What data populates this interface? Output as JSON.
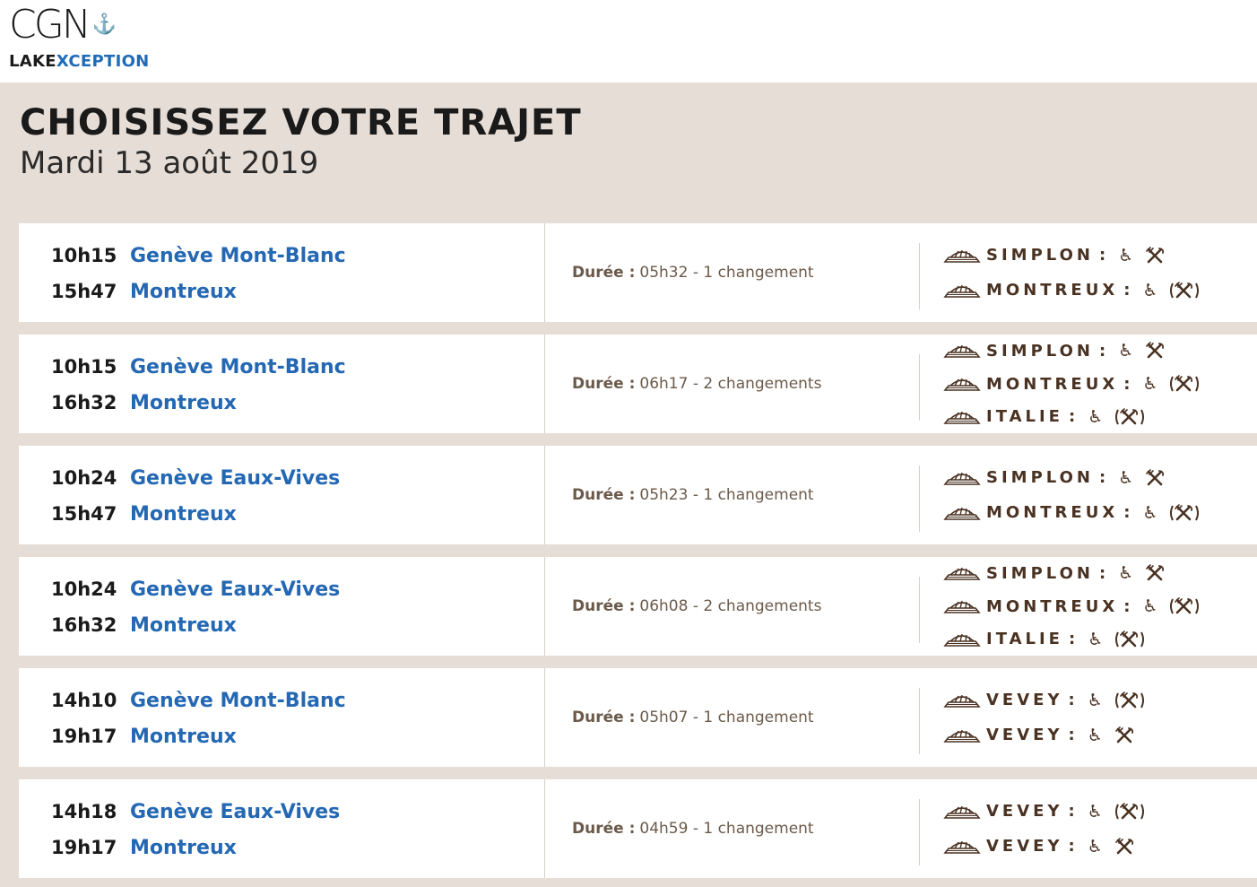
{
  "brand": {
    "logo_text": "CGN",
    "logo_anchor": "⚓",
    "tagline_a": "LAKE",
    "tagline_b": "XCEPTION"
  },
  "page": {
    "title": "CHOISISSEZ VOTRE TRAJET",
    "date": "Mardi 13 août 2019"
  },
  "duration_label": "Durée :",
  "trips": [
    {
      "dep_time": "10h15",
      "dep_place": "Genève Mont-Blanc",
      "arr_time": "15h47",
      "arr_place": "Montreux",
      "duration": "05h32 - 1 changement",
      "boats": [
        {
          "name": "SIMPLON",
          "restaurant": "yes"
        },
        {
          "name": "MONTREUX",
          "restaurant": "optional"
        }
      ]
    },
    {
      "dep_time": "10h15",
      "dep_place": "Genève Mont-Blanc",
      "arr_time": "16h32",
      "arr_place": "Montreux",
      "duration": "06h17 - 2 changements",
      "boats": [
        {
          "name": "SIMPLON",
          "restaurant": "yes"
        },
        {
          "name": "MONTREUX",
          "restaurant": "optional"
        },
        {
          "name": "ITALIE",
          "restaurant": "optional"
        }
      ]
    },
    {
      "dep_time": "10h24",
      "dep_place": "Genève Eaux-Vives",
      "arr_time": "15h47",
      "arr_place": "Montreux",
      "duration": "05h23 - 1 changement",
      "boats": [
        {
          "name": "SIMPLON",
          "restaurant": "yes"
        },
        {
          "name": "MONTREUX",
          "restaurant": "optional"
        }
      ]
    },
    {
      "dep_time": "10h24",
      "dep_place": "Genève Eaux-Vives",
      "arr_time": "16h32",
      "arr_place": "Montreux",
      "duration": "06h08 - 2 changements",
      "boats": [
        {
          "name": "SIMPLON",
          "restaurant": "yes"
        },
        {
          "name": "MONTREUX",
          "restaurant": "optional"
        },
        {
          "name": "ITALIE",
          "restaurant": "optional"
        }
      ]
    },
    {
      "dep_time": "14h10",
      "dep_place": "Genève Mont-Blanc",
      "arr_time": "19h17",
      "arr_place": "Montreux",
      "duration": "05h07 - 1 changement",
      "boats": [
        {
          "name": "VEVEY",
          "restaurant": "optional"
        },
        {
          "name": "VEVEY",
          "restaurant": "yes"
        }
      ]
    },
    {
      "dep_time": "14h18",
      "dep_place": "Genève Eaux-Vives",
      "arr_time": "19h17",
      "arr_place": "Montreux",
      "duration": "04h59 - 1 changement",
      "boats": [
        {
          "name": "VEVEY",
          "restaurant": "optional"
        },
        {
          "name": "VEVEY",
          "restaurant": "yes"
        }
      ]
    }
  ],
  "icons": {
    "boat": "paddle-steamer-icon",
    "accessible": "wheelchair-icon",
    "restaurant": "restaurant-icon",
    "restaurant_optional": "restaurant-optional-icon"
  },
  "colors": {
    "band": "#e6ddd6",
    "link": "#2468b4",
    "accent_brown": "#4a3222",
    "duration_text": "#6b5a4a"
  }
}
